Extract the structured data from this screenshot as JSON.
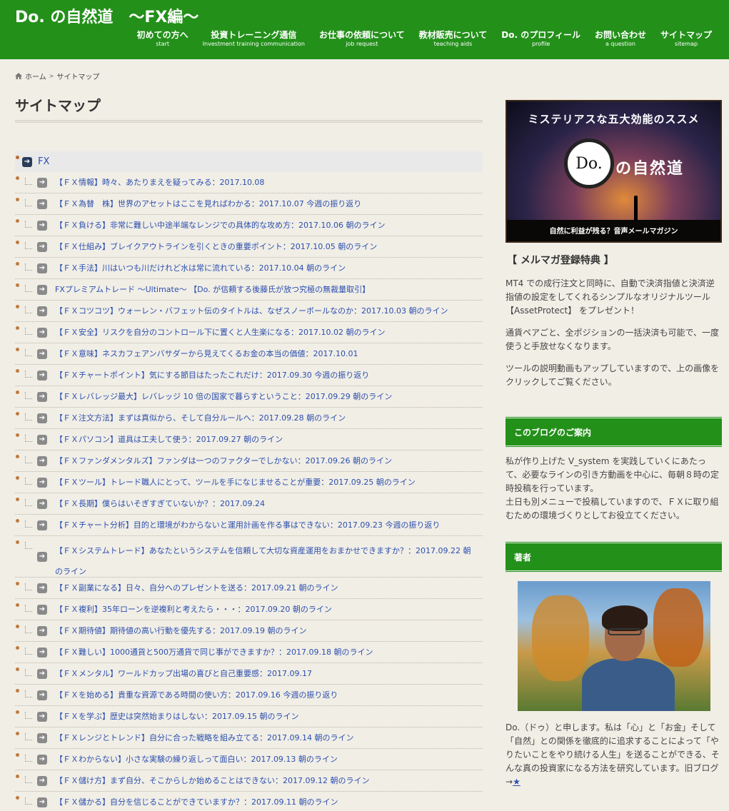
{
  "header": {
    "site_title": "Do. の自然道　～FX編～",
    "nav": [
      {
        "jp": "初めての方へ",
        "en": "start"
      },
      {
        "jp": "投資トレーニング通信",
        "en": "Investment training communication"
      },
      {
        "jp": "お仕事の依頼について",
        "en": "job request"
      },
      {
        "jp": "教材販売について",
        "en": "teaching aids"
      },
      {
        "jp": "Do. のプロフィール",
        "en": "profile"
      },
      {
        "jp": "お問い合わせ",
        "en": "a question"
      },
      {
        "jp": "サイトマップ",
        "en": "sitemap"
      }
    ]
  },
  "breadcrumb": {
    "home": "ホーム",
    "sep": ">",
    "current": "サイトマップ"
  },
  "page_title": "サイトマップ",
  "category": "FX",
  "posts": [
    "【ＦＸ情報】時々、あたりまえを疑ってみる：2017.10.08",
    "【ＦＸ為替　株】世界のアセットはここを見ればわかる：2017.10.07 今週の振り返り",
    "【ＦＸ負ける】非常に難しい中途半端なレンジでの具体的な攻め方：2017.10.06 朝のライン",
    "【ＦＸ仕組み】ブレイクアウトラインを引くときの重要ポイント：2017.10.05 朝のライン",
    "【ＦＸ手法】川はいつも川だけれど水は常に流れている：2017.10.04 朝のライン",
    "FXプレミアムトレード ～Ultimate～ 【Do. が信頼する後藤氏が放つ究極の無裁量取引】",
    "【ＦＸコツコツ】ウォーレン・バフェット伝のタイトルは、なぜスノーボールなのか：2017.10.03 朝のライン",
    "【ＦＸ安全】リスクを自分のコントロール下に置くと人生楽になる：2017.10.02 朝のライン",
    "【ＦＸ意味】ネスカフェアンバサダーから見えてくるお金の本当の価値：2017.10.01",
    "【ＦＸチャートポイント】気にする節目はたったこれだけ：2017.09.30 今週の振り返り",
    "【ＦＸレバレッジ最大】レバレッジ 10 倍の国家で暮らすということ：2017.09.29 朝のライン",
    "【ＦＸ注文方法】まずは真似から、そして自分ルールへ：2017.09.28 朝のライン",
    "【ＦＸパソコン】道具は工夫して使う：2017.09.27 朝のライン",
    "【ＦＸファンダメンタルズ】ファンダは一つのファクターでしかない：2017.09.26 朝のライン",
    "【ＦＸツール】トレード職人にとって、ツールを手になじませることが重要：2017.09.25 朝のライン",
    "【ＦＸ長期】僕らはいそぎすぎていないか？：2017.09.24",
    "【ＦＸチャート分析】目的と環境がわからないと運用計画を作る事はできない：2017.09.23 今週の振り返り",
    "【ＦＸシステムトレード】あなたというシステムを信頼して大切な資産運用をおまかせできますか？：2017.09.22 朝のライン",
    "【ＦＸ副業になる】日々、自分へのプレゼントを送る：2017.09.21 朝のライン",
    "【ＦＸ複利】35年ローンを逆複利と考えたら・・・：2017.09.20 朝のライン",
    "【ＦＸ期待値】期待値の高い行動を優先する：2017.09.19 朝のライン",
    "【ＦＸ難しい】1000通貨と500万通貨で同じ事ができますか？：2017.09.18 朝のライン",
    "【ＦＸメンタル】ワールドカップ出場の喜びと自己重要感：2017.09.17",
    "【ＦＸを始める】貴重な資源である時間の使い方：2017.09.16 今週の振り返り",
    "【ＦＸを学ぶ】歴史は突然始まりはしない：2017.09.15 朝のライン",
    "【ＦＸレンジとトレンド】自分に合った戦略を組み立てる：2017.09.14 朝のライン",
    "【ＦＸわからない】小さな実験の繰り返しって面白い：2017.09.13 朝のライン",
    "【ＦＸ儲け方】まず自分、そこからしか始めることはできない：2017.09.12 朝のライン",
    "【ＦＸ儲かる】自分を信じることができていますか？：2017.09.11 朝のライン"
  ],
  "sidebar": {
    "banner_title": "ミステリアスな五大効能のススメ",
    "banner_logo": "Do.",
    "banner_logo_text": "の自然道",
    "banner_sub": "自然に利益が残る？音声メールマガジン",
    "mailmag_heading": "【 メルマガ登録特典 】",
    "mailmag_p1": "MT4 での成行注文と同時に、自動で決済指値と決済逆指値の設定をしてくれるシンプルなオリジナルツール 【AssetProtect】 をプレゼント！",
    "mailmag_p2": "通貨ペアごと、全ポジションの一括決済も可能で、一度使うと手放せなくなります。",
    "mailmag_p3": "ツールの説明動画もアップしていますので、上の画像をクリックしてご覧ください。",
    "guide_heading": "このブログのご案内",
    "guide_p1": "私が作り上げた V_system を実践していくにあたって、必要なラインの引き方動画を中心に、毎朝８時の定時投稿を行っています。",
    "guide_p2": "土日も別メニューで投稿していますので、ＦＸに取り組むための環境づくりとしてお役立てください。",
    "author_heading": "著者",
    "author_text": "Do.（ドゥ）と申します。私は「心」と「お金」そして「自然」との関係を徹底的に追求することによって「やりたいことをやり続ける人生」を送ることができる、そんな真の投資家になる方法を研究しています。旧ブログ→",
    "author_link": "★"
  },
  "colors": {
    "header_green": "#23901a",
    "link_blue": "#2b4fae",
    "background": "#f1eee6"
  }
}
